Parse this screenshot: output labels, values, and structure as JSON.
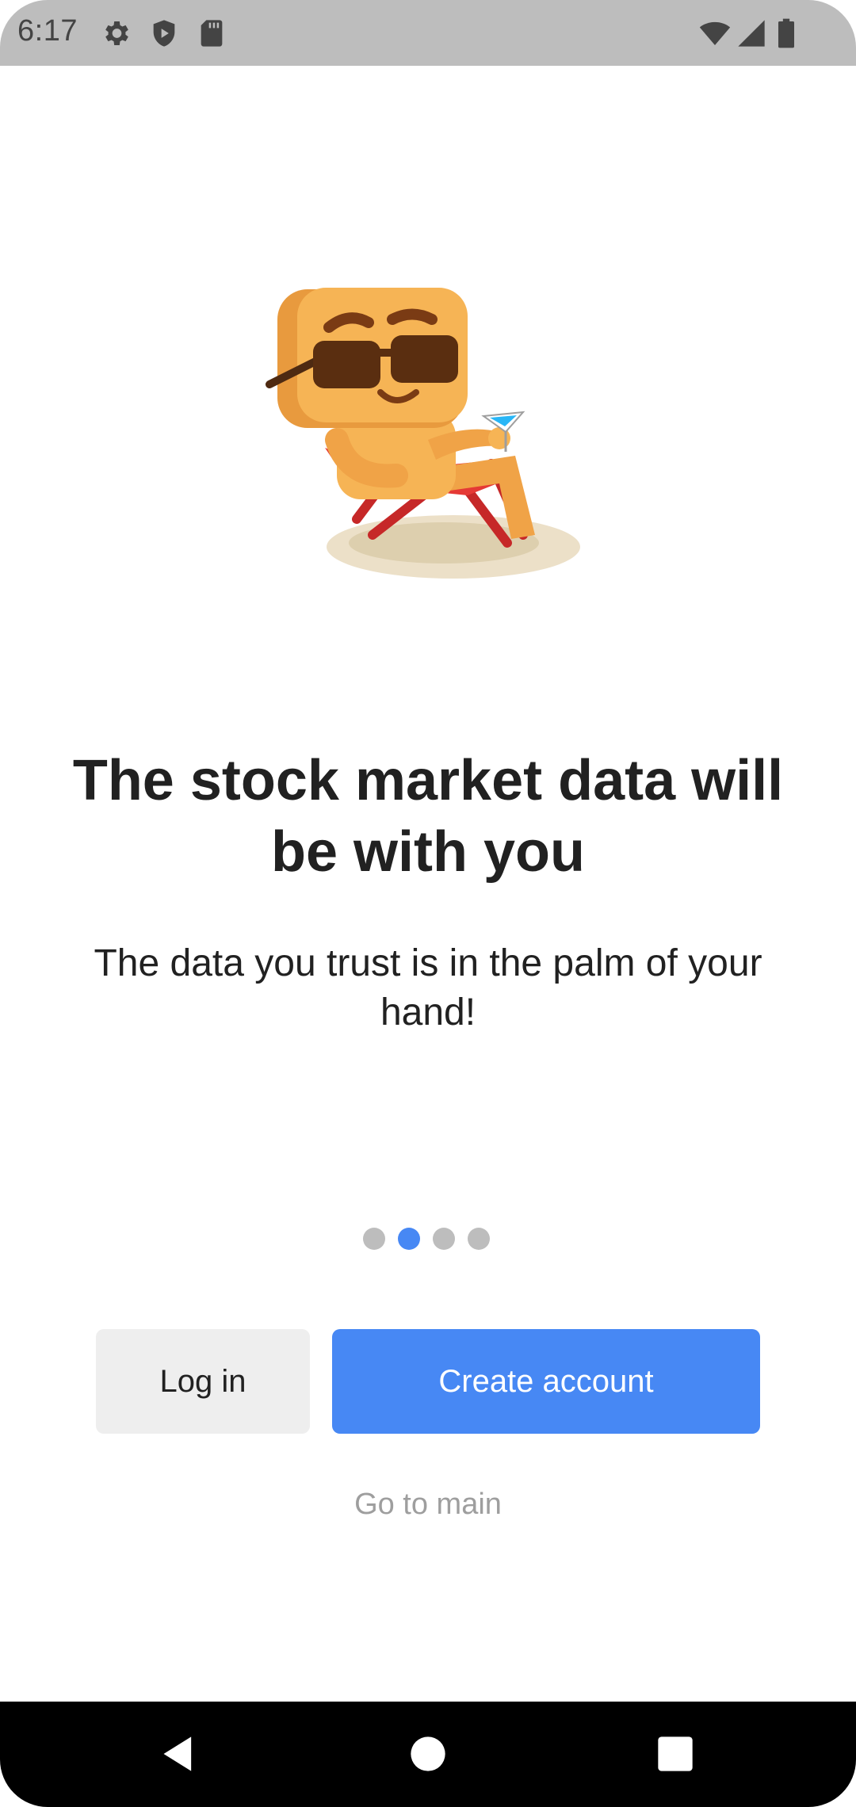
{
  "status_bar": {
    "time": "6:17",
    "left_icons": [
      "gear-icon",
      "shield-play-icon",
      "sd-card-icon"
    ],
    "right_icons": [
      "wifi-icon",
      "signal-icon",
      "battery-icon"
    ]
  },
  "onboarding": {
    "illustration": "relaxing-character-illustration",
    "headline": "The stock market data will be with you",
    "subline": "The data you trust is in the palm of your hand!",
    "page_indicator": {
      "total": 4,
      "active_index": 1
    }
  },
  "actions": {
    "login_label": "Log in",
    "create_account_label": "Create account",
    "go_to_main_label": "Go to main"
  },
  "colors": {
    "accent": "#4788f4",
    "status_bar_bg": "#bdbdbd",
    "secondary_button_bg": "#eeeeee",
    "muted_text": "#9e9e9e"
  },
  "nav_bar": {
    "buttons": [
      "back-icon",
      "home-icon",
      "recents-icon"
    ]
  }
}
